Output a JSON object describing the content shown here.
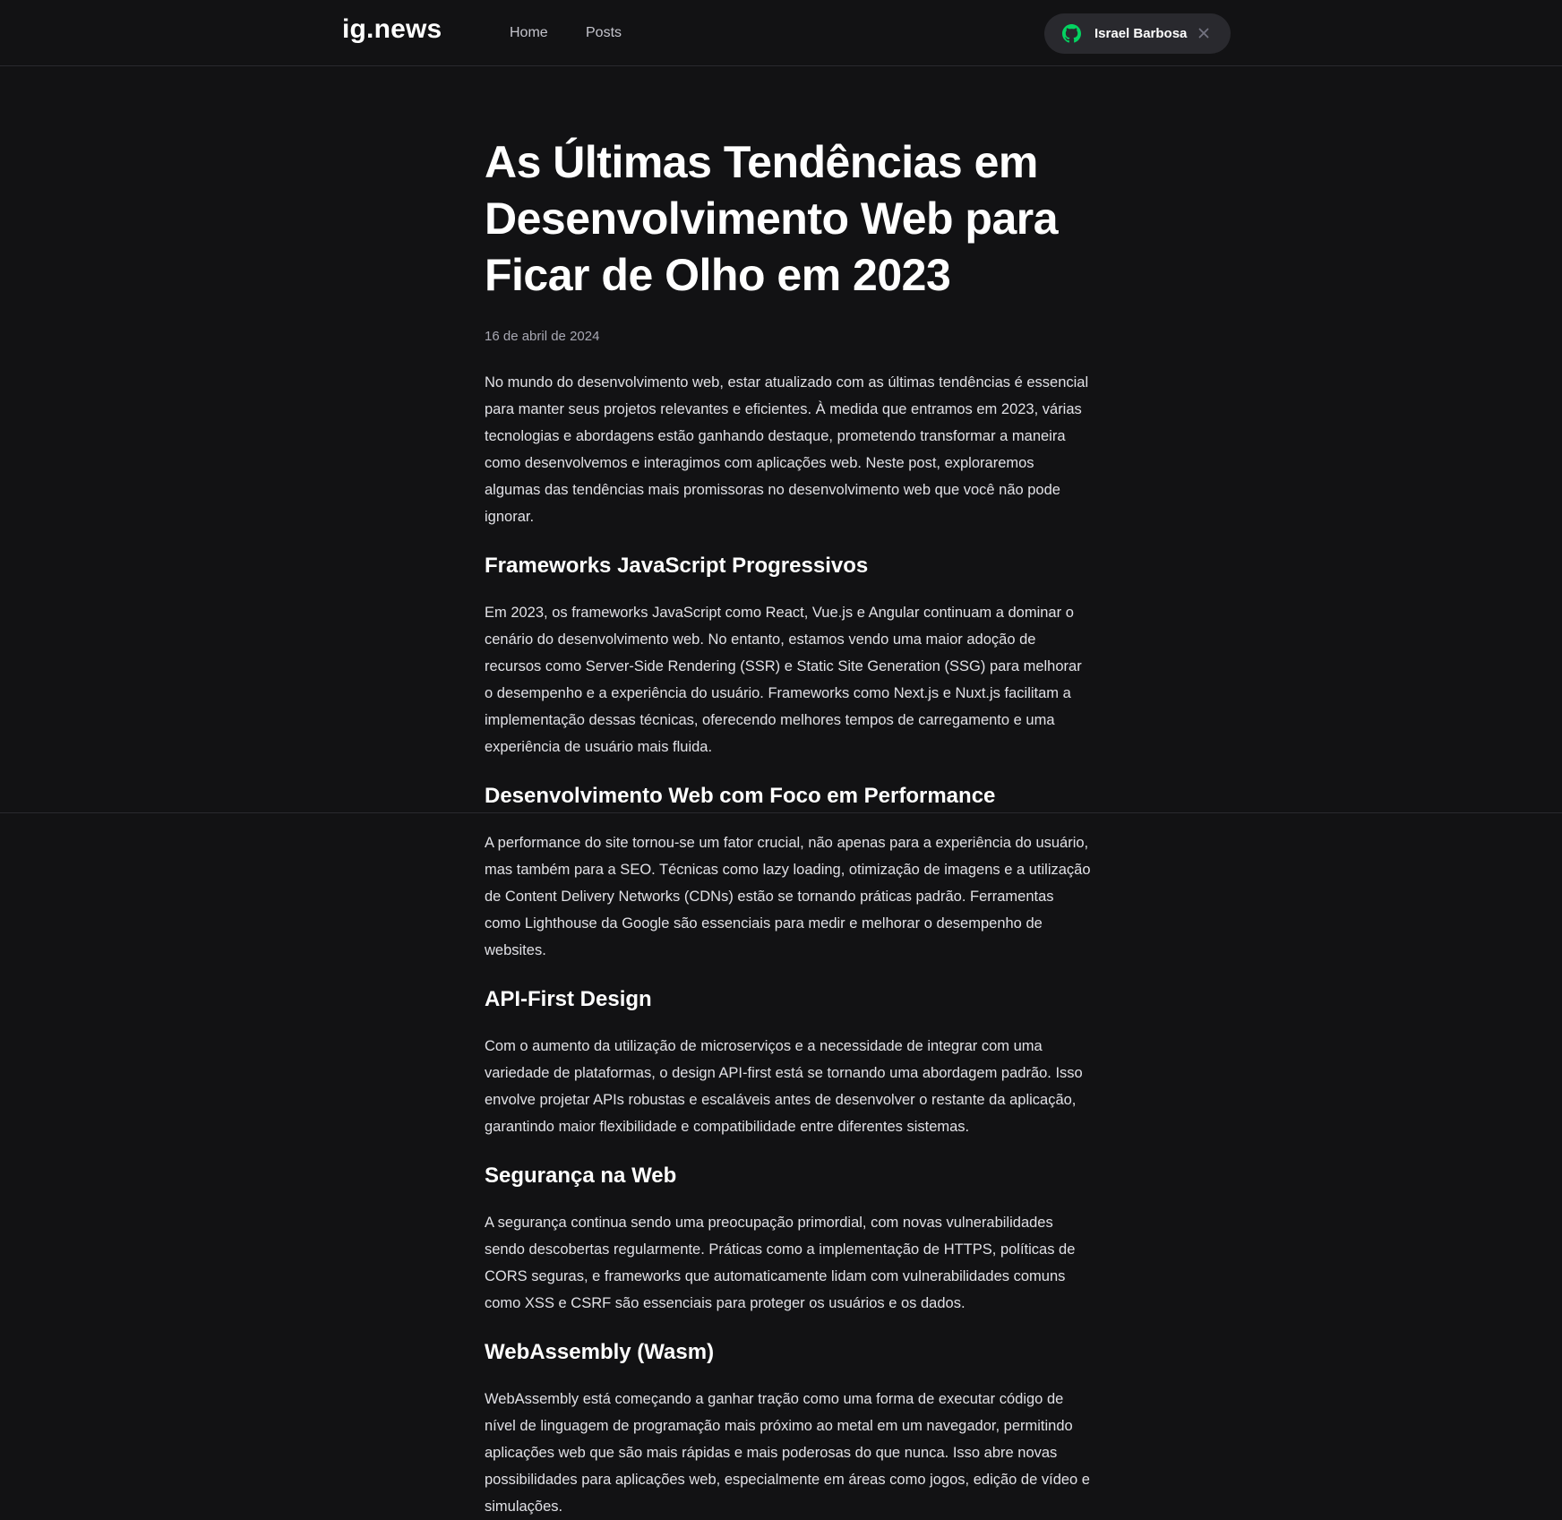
{
  "header": {
    "logo": "ig.news",
    "nav": {
      "home": "Home",
      "posts": "Posts"
    },
    "user": {
      "name": "Israel Barbosa",
      "icon": "github-icon",
      "close_icon": "close-icon"
    }
  },
  "colors": {
    "background": "#121214",
    "header_border": "#29292e",
    "github_green": "#04d361",
    "button_bg": "#29292e",
    "text": "#e1e1e6",
    "muted": "#a8a8b3"
  },
  "article": {
    "title": "As Últimas Tendências em Desenvolvimento Web para Ficar de Olho em 2023",
    "date": "16 de abril de 2024",
    "intro": "No mundo do desenvolvimento web, estar atualizado com as últimas tendências é essencial para manter seus projetos relevantes e eficientes. À medida que entramos em 2023, várias tecnologias e abordagens estão ganhando destaque, prometendo transformar a maneira como desenvolvemos e interagimos com aplicações web. Neste post, exploraremos algumas das tendências mais promissoras no desenvolvimento web que você não pode ignorar.",
    "sections": [
      {
        "heading": "Frameworks JavaScript Progressivos",
        "body": "Em 2023, os frameworks JavaScript como React, Vue.js e Angular continuam a dominar o cenário do desenvolvimento web. No entanto, estamos vendo uma maior adoção de recursos como Server-Side Rendering (SSR) e Static Site Generation (SSG) para melhorar o desempenho e a experiência do usuário. Frameworks como Next.js e Nuxt.js facilitam a implementação dessas técnicas, oferecendo melhores tempos de carregamento e uma experiência de usuário mais fluida."
      },
      {
        "heading": "Desenvolvimento Web com Foco em Performance",
        "body": "A performance do site tornou-se um fator crucial, não apenas para a experiência do usuário, mas também para a SEO. Técnicas como lazy loading, otimização de imagens e a utilização de Content Delivery Networks (CDNs) estão se tornando práticas padrão. Ferramentas como Lighthouse da Google são essenciais para medir e melhorar o desempenho de websites."
      },
      {
        "heading": "API-First Design",
        "body": "Com o aumento da utilização de microserviços e a necessidade de integrar com uma variedade de plataformas, o design API-first está se tornando uma abordagem padrão. Isso envolve projetar APIs robustas e escaláveis antes de desenvolver o restante da aplicação, garantindo maior flexibilidade e compatibilidade entre diferentes sistemas."
      },
      {
        "heading": "Segurança na Web",
        "body": "A segurança continua sendo uma preocupação primordial, com novas vulnerabilidades sendo descobertas regularmente. Práticas como a implementação de HTTPS, políticas de CORS seguras, e frameworks que automaticamente lidam com vulnerabilidades comuns como XSS e CSRF são essenciais para proteger os usuários e os dados."
      },
      {
        "heading": "WebAssembly (Wasm)",
        "body": "WebAssembly está começando a ganhar tração como uma forma de executar código de nível de linguagem de programação mais próximo ao metal em um navegador, permitindo aplicações web que são mais rápidas e mais poderosas do que nunca. Isso abre novas possibilidades para aplicações web, especialmente em áreas como jogos, edição de vídeo e simulações."
      }
    ]
  }
}
